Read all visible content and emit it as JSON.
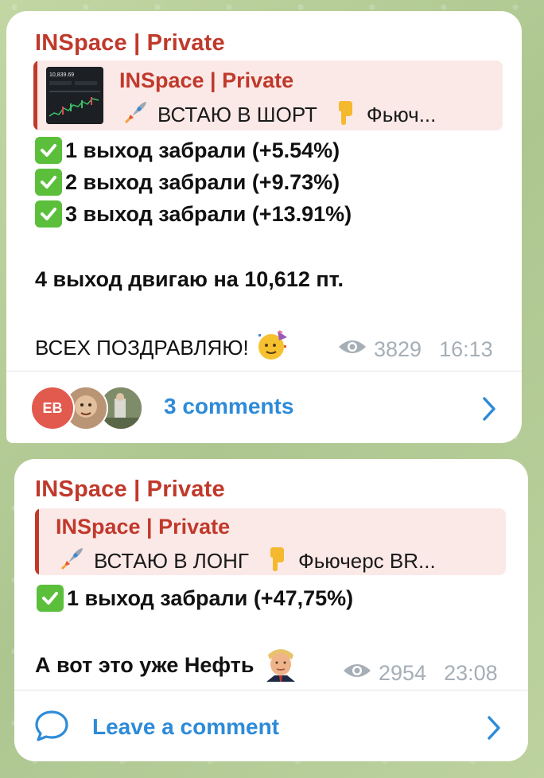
{
  "colors": {
    "sender": "#c0392b",
    "reply_bg": "#fbe9e7",
    "check": "#5bbf3c",
    "link": "#2d8bd8",
    "meta": "#a6aeb6"
  },
  "messages": [
    {
      "sender": "INSpace | Private",
      "reply": {
        "title": "INSpace | Private",
        "text": "ВСТАЮ В ШОРТ",
        "text_tail": "Фьюч...",
        "thumb_text": "10,839.69"
      },
      "lines": [
        "1 выход забрали (+5.54%)",
        "2 выход забрали (+9.73%)",
        "3 выход забрали (+13.91%)"
      ],
      "text1": "4 выход двигаю на 10,612 пт.",
      "text2": "ВСЕХ ПОЗДРАВЛЯЮ!",
      "views": "3829",
      "time": "16:13",
      "avatar_initials": "EB",
      "comments": "3 comments"
    },
    {
      "sender": "INSpace | Private",
      "reply": {
        "title": "INSpace | Private",
        "text": "ВСТАЮ В ЛОНГ",
        "text_tail": "Фьючерс BR..."
      },
      "lines": [
        "1 выход забрали (+47,75%)"
      ],
      "text1": "А вот это уже Нефть",
      "views": "2954",
      "time": "23:08",
      "comments": "Leave a comment"
    }
  ]
}
